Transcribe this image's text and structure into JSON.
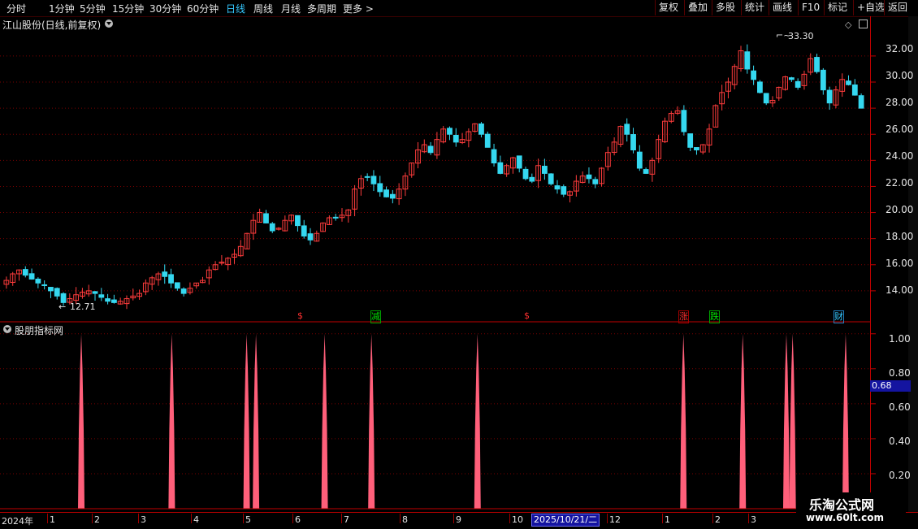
{
  "toolbar": {
    "left_items": [
      "分时",
      "1分钟",
      "5分钟",
      "15分钟",
      "30分钟",
      "60分钟",
      "日线",
      "周线",
      "月线",
      "多周期",
      "更多 >"
    ],
    "active_index": 6,
    "right_items": [
      "复权",
      "叠加",
      "多股",
      "统计",
      "画线",
      "F10",
      "标记",
      "+自选",
      "返回"
    ]
  },
  "main_panel": {
    "title": "江山股份(日线,前复权)",
    "y_ticks": [
      "32.00",
      "30.00",
      "28.00",
      "26.00",
      "24.00",
      "22.00",
      "20.00",
      "18.00",
      "16.00",
      "14.00"
    ],
    "high_label": "33.30",
    "low_label": "12.71",
    "signals": [
      {
        "text": "$",
        "color": "#ff3030"
      },
      {
        "text": "减",
        "color": "#00e000"
      },
      {
        "text": "$",
        "color": "#ff3030"
      },
      {
        "text": "涨",
        "color": "#ff3030"
      },
      {
        "text": "跌",
        "color": "#00e000"
      },
      {
        "text": "财",
        "color": "#35c8ff"
      }
    ]
  },
  "sub_panel": {
    "title": "股朋指标网",
    "y_ticks": [
      "1.00",
      "0.80",
      "0.60",
      "0.40",
      "0.20"
    ],
    "current_value": "0.68"
  },
  "date_axis": {
    "labels": [
      "2024年",
      "1",
      "2",
      "3",
      "4",
      "5",
      "6",
      "7",
      "8",
      "9",
      "10",
      "11",
      "12",
      "1",
      "2",
      "3"
    ],
    "highlight": "2025/10/21/二"
  },
  "watermark": {
    "title": "乐淘公式网",
    "url": "www.60lt.com"
  },
  "colors": {
    "up": "#ff3c3c",
    "down": "#35d8f0",
    "spike": "#ff5f7a",
    "grid": "#7a0000",
    "axis": "#c00000"
  },
  "chart_data": [
    {
      "type": "candlestick",
      "title": "江山股份(日线,前复权)",
      "ylim": [
        12.0,
        33.8
      ],
      "y_ticks": [
        14,
        16,
        18,
        20,
        22,
        24,
        26,
        28,
        30,
        32
      ],
      "annotations": [
        {
          "text": "33.30",
          "value": 33.3
        },
        {
          "text": "12.71",
          "value": 12.71
        }
      ],
      "close_series": [
        14.8,
        15.3,
        15.6,
        15.2,
        14.9,
        14.6,
        14.4,
        14.0,
        13.6,
        13.1,
        13.4,
        13.7,
        13.9,
        14.0,
        13.8,
        13.5,
        13.2,
        13.1,
        13.2,
        13.4,
        13.6,
        13.8,
        14.6,
        15.0,
        15.3,
        15.1,
        14.6,
        14.2,
        13.8,
        14.2,
        14.6,
        14.8,
        15.6,
        16.0,
        16.2,
        16.5,
        16.8,
        17.4,
        18.4,
        19.4,
        20.0,
        19.2,
        18.6,
        18.8,
        19.4,
        19.8,
        19.0,
        18.2,
        17.9,
        18.4,
        19.2,
        19.6,
        19.6,
        19.8,
        20.2,
        21.8,
        22.6,
        22.7,
        22.2,
        21.6,
        21.2,
        21.1,
        21.8,
        22.8,
        23.8,
        24.8,
        25.2,
        24.6,
        25.6,
        26.4,
        26.0,
        25.4,
        25.6,
        26.2,
        26.8,
        26.0,
        25.0,
        23.8,
        23.0,
        23.6,
        24.2,
        23.4,
        22.6,
        22.4,
        23.6,
        23.0,
        22.2,
        21.8,
        21.4,
        21.6,
        22.4,
        22.8,
        22.6,
        22.2,
        23.4,
        24.6,
        25.4,
        26.6,
        26.0,
        24.8,
        23.4,
        23.0,
        24.0,
        25.6,
        27.0,
        27.6,
        27.8,
        26.2,
        25.0,
        24.8,
        25.2,
        26.4,
        28.2,
        29.2,
        30.0,
        31.2,
        32.4,
        31.0,
        30.2,
        29.2,
        28.4,
        28.6,
        29.6,
        30.4,
        30.2,
        29.6,
        30.6,
        31.8,
        30.8,
        29.4,
        28.4,
        29.4,
        30.2,
        29.8,
        29.0,
        28.0
      ]
    },
    {
      "type": "bar",
      "title": "股朋指标网",
      "ylim": [
        0,
        1.05
      ],
      "y_ticks": [
        0.2,
        0.4,
        0.6,
        0.8,
        1.0
      ],
      "spike_positions": [
        25,
        54,
        78,
        81,
        103,
        118,
        152,
        218,
        237,
        251,
        253,
        270
      ],
      "values": [
        1,
        1,
        1,
        1,
        1,
        1,
        1,
        1,
        1,
        1,
        1,
        1
      ],
      "current_value": 0.68
    }
  ]
}
